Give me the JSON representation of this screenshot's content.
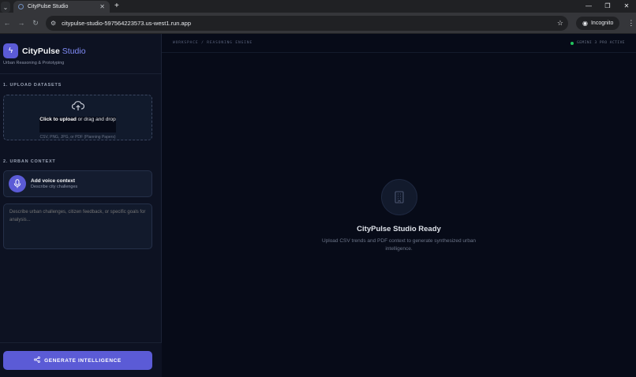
{
  "browser": {
    "tab_menu_icon": "chevron-down-icon",
    "tab_title": "CityPulse Studio",
    "tab_close": "✕",
    "new_tab": "+",
    "url": "citypulse-studio-597564223573.us-west1.run.app",
    "incognito_label": "Incognito",
    "window_minimize": "—",
    "window_restore": "❐",
    "window_close": "✕"
  },
  "sidebar": {
    "brand_name": "CityPulse",
    "brand_accent": "Studio",
    "brand_sub": "Urban Reasoning & Prototyping",
    "section1_label": "1. UPLOAD DATASETS",
    "upload_cta_bold": "Click to upload",
    "upload_cta_rest": "or drag and drop",
    "upload_hint": "CSV, PNG, JPG, or PDF (Planning Papers)",
    "section2_label": "2. URBAN CONTEXT",
    "voice_title": "Add voice context",
    "voice_sub": "Describe city challenges",
    "textarea_placeholder": "Describe urban challenges, citizen feedback, or specific goals for analysis...",
    "generate_label": "GENERATE INTELLIGENCE"
  },
  "main": {
    "breadcrumb": "WORKSPACE / REASONING ENGINE",
    "status": "GEMINI 3 PRO ACTIVE",
    "status_color": "#22c55e",
    "empty_title": "CityPulse Studio Ready",
    "empty_sub": "Upload CSV trends and PDF context to generate synthesized urban intelligence."
  },
  "colors": {
    "accent": "#5b5bd6",
    "accent_text": "#818cf8"
  }
}
